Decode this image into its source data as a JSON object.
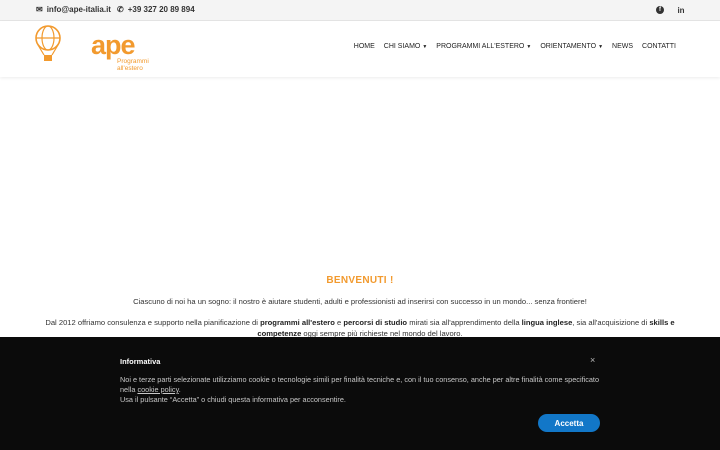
{
  "topbar": {
    "email": "info@ape-italia.it",
    "phone": "+39 327 20 89 894",
    "icons": {
      "email": "envelope-icon",
      "phone": "phone-icon",
      "facebook": "facebook-icon",
      "linkedin": "linkedin-icon"
    },
    "linkedin_glyph": "in"
  },
  "logo": {
    "wordmark": "ape",
    "tagline_line1": "Programmi",
    "tagline_line2": "all'estero",
    "color": "#f29a2e"
  },
  "nav": {
    "items": [
      {
        "label": "HOME",
        "dropdown": false
      },
      {
        "label": "CHI SIAMO",
        "dropdown": true
      },
      {
        "label": "PROGRAMMI ALL'ESTERO",
        "dropdown": true
      },
      {
        "label": "ORIENTAMENTO",
        "dropdown": true
      },
      {
        "label": "NEWS",
        "dropdown": false
      },
      {
        "label": "CONTATTI",
        "dropdown": false
      }
    ]
  },
  "main": {
    "title": "BENVENUTI !",
    "para1": "Ciascuno di noi ha un sogno: il nostro è aiutare studenti, adulti e professionisti ad inserirsi con successo in un mondo... senza frontiere!",
    "para2": {
      "t1": "Dal 2012 offriamo consulenza e supporto nella pianificazione di ",
      "b1": "programmi all'estero",
      "t2": " e ",
      "b2": "percorsi di studio",
      "t3": " mirati sia all'apprendimento della ",
      "b3": "lingua inglese",
      "t4": ", sia all'acquisizione di ",
      "b4": "skills e competenze",
      "t5": " oggi sempre più richieste nel mondo del lavoro."
    }
  },
  "cookie": {
    "title": "Informativa",
    "line1": "Noi e terze parti selezionate utilizziamo cookie o tecnologie simili per finalità tecniche e, con il tuo consenso, anche per altre finalità come specificato nella ",
    "link": "cookie policy",
    "line1_end": ".",
    "line2": "Usa il pulsante “Accetta” o chiudi questa informativa per acconsentire.",
    "accept_label": "Accetta",
    "close_glyph": "×",
    "accent": "#1277c8"
  }
}
